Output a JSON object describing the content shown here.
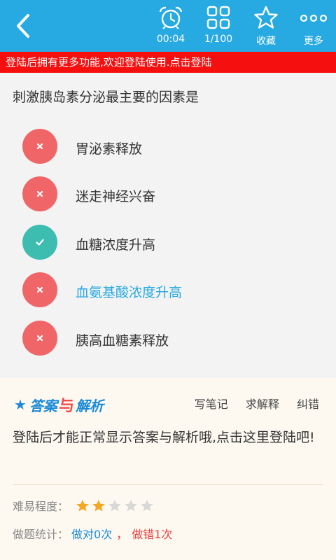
{
  "toolbar": {
    "timer": "00:04",
    "progress": "1/100",
    "favorite": "收藏",
    "more": "更多"
  },
  "banner": "登陆后拥有更多功能,欢迎登陆使用.点击登陆",
  "question": {
    "text": "刺激胰岛素分泌最主要的因素是",
    "options": [
      {
        "text": "胃泌素释放",
        "state": "wrong"
      },
      {
        "text": "迷走神经兴奋",
        "state": "wrong"
      },
      {
        "text": "血糖浓度升高",
        "state": "correct"
      },
      {
        "text": "血氨基酸浓度升高",
        "state": "wrong-selected"
      },
      {
        "text": "胰高血糖素释放",
        "state": "wrong"
      }
    ]
  },
  "answer": {
    "title_part1": "答案",
    "title_part2": "与",
    "title_part3": "解析",
    "actions": [
      "写笔记",
      "求解释",
      "纠错"
    ],
    "message": "登陆后才能正常显示答案与解析哦,点击这里登陆吧!",
    "difficulty_label": "难易程度：",
    "difficulty_rating": 2,
    "difficulty_max": 5,
    "stats_label": "做题统计：",
    "stats_right": "做对0次",
    "stats_sep": "，",
    "stats_wrong": "做错1次"
  },
  "colors": {
    "primary": "#27a9e1",
    "banner": "#f50f0f",
    "wrong": "#f06668",
    "correct": "#3dbdb0",
    "star_on": "#f5a623",
    "star_off": "#d8d8d8"
  }
}
